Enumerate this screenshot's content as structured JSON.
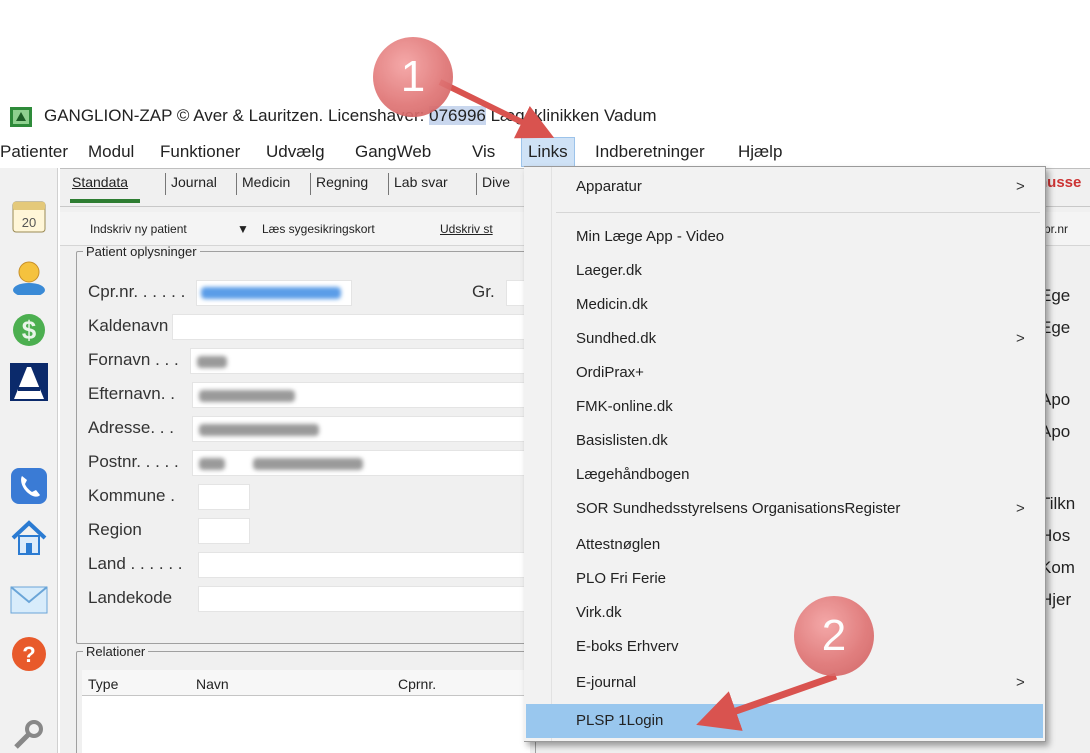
{
  "window": {
    "title_prefix": "GANGLION-ZAP  © Aver & Lauritzen.  Licenshaver: ",
    "license_number": "076996",
    "title_suffix": " Lægeklinikken Vadum"
  },
  "menubar": {
    "items": [
      "Patienter",
      "Modul",
      "Funktioner",
      "Udvælg",
      "GangWeb",
      "Vis",
      "Links",
      "Indberetninger",
      "Hjælp"
    ],
    "active": "Links"
  },
  "left_toolbar": {
    "calendar_day": "20",
    "icons": [
      "calendar-icon",
      "person-icon",
      "dollar-icon",
      "road-icon",
      "phone-icon",
      "home-icon",
      "mail-icon",
      "help-icon",
      "tools-icon"
    ]
  },
  "tabs": [
    "Standata",
    "Journal",
    "Medicin",
    "Regning",
    "Lab svar",
    "Dive"
  ],
  "actionbar": {
    "new_patient": "Indskriv ny patient",
    "dropdown_caret": "▼",
    "read_card": "Læs sygesikringskort",
    "print": "Udskriv st",
    "right_fragment": "pr.nr"
  },
  "patient_group": {
    "legend": "Patient oplysninger",
    "fields": [
      {
        "label": "Cpr.nr. . . . . .",
        "key": "cpr"
      },
      {
        "label": "Kaldenavn",
        "key": "kaldenavn"
      },
      {
        "label": "Fornavn . . .",
        "key": "fornavn"
      },
      {
        "label": "Efternavn. .",
        "key": "efternavn"
      },
      {
        "label": "Adresse. . .",
        "key": "adresse"
      },
      {
        "label": "Postnr. . . . .",
        "key": "postnr"
      },
      {
        "label": "Kommune .",
        "key": "kommune"
      },
      {
        "label": "Region",
        "key": "region"
      },
      {
        "label": "Land . . . . . .",
        "key": "land"
      },
      {
        "label": "Landekode",
        "key": "landekode"
      }
    ],
    "gr_label": "Gr."
  },
  "right_panel": {
    "header_fragment": "husse",
    "labels": [
      "Ege",
      "Ege",
      "Apo",
      "Apo",
      "Tilkn",
      "Hos",
      "Kom",
      "Hjer"
    ]
  },
  "relations_group": {
    "legend": "Relationer",
    "columns": [
      "Type",
      "Navn",
      "Cprnr."
    ]
  },
  "links_menu": {
    "items": [
      {
        "label": "Apparatur",
        "submenu": true
      },
      {
        "label": "Min Læge App - Video",
        "submenu": false
      },
      {
        "label": "Laeger.dk",
        "submenu": false
      },
      {
        "label": "Medicin.dk",
        "submenu": false
      },
      {
        "label": "Sundhed.dk",
        "submenu": true
      },
      {
        "label": "OrdiPrax+",
        "submenu": false
      },
      {
        "label": "FMK-online.dk",
        "submenu": false
      },
      {
        "label": "Basislisten.dk",
        "submenu": false
      },
      {
        "label": "Lægehåndbogen",
        "submenu": false
      },
      {
        "label": "SOR Sundhedsstyrelsens OrganisationsRegister",
        "submenu": true
      },
      {
        "label": "Attestnøglen",
        "submenu": false
      },
      {
        "label": "PLO Fri Ferie",
        "submenu": false
      },
      {
        "label": "Virk.dk",
        "submenu": false
      },
      {
        "label": "E-boks Erhverv",
        "submenu": false
      },
      {
        "label": "E-journal",
        "submenu": true
      },
      {
        "label": "PLSP 1Login",
        "submenu": false
      }
    ],
    "highlighted": "PLSP 1Login",
    "submenu_arrow": ">"
  },
  "callouts": [
    "1",
    "2"
  ],
  "colors": {
    "highlight": "#99c7ee",
    "callout": "#e07676",
    "arrow": "#d9534f",
    "tab_active_underline": "#2e7d32",
    "alert_text": "#cc3333"
  }
}
